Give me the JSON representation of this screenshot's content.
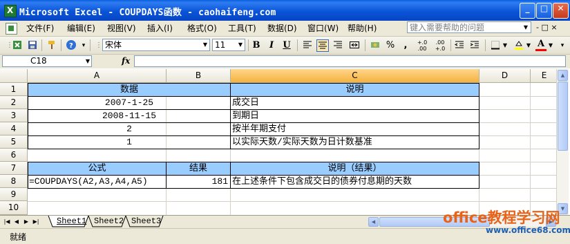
{
  "window": {
    "title": "Microsoft Excel - COUPDAYS函数 - caohaifeng.com",
    "buttons": {
      "minimize": "_",
      "maximize": "□",
      "close": "✕"
    }
  },
  "menu": {
    "items": [
      "文件(F)",
      "编辑(E)",
      "视图(V)",
      "插入(I)",
      "格式(O)",
      "工具(T)",
      "数据(D)",
      "窗口(W)",
      "帮助(H)"
    ],
    "help_placeholder": "键入需要帮助的问题",
    "controls": "- ♬ ×"
  },
  "toolbar": {
    "font_name": "宋体",
    "font_size": "11",
    "icons": [
      "excel-icon",
      "save-icon",
      "print-icon",
      "help-icon",
      "bold-icon",
      "italic-icon",
      "underline-icon",
      "align-left-icon",
      "align-center-icon",
      "align-right-icon",
      "merge-center-icon",
      "currency-icon",
      "percent-icon",
      "comma-icon",
      "increase-decimal-icon",
      "decrease-decimal-icon",
      "decrease-indent-icon",
      "increase-indent-icon",
      "borders-icon",
      "fill-color-icon",
      "font-color-icon"
    ],
    "bold_label": "B",
    "italic_label": "I",
    "underline_label": "U",
    "percent_label": "%",
    "comma_label": ",",
    "inc_decimal_label": "+.0 .00",
    "dec_decimal_label": ".00 +.0",
    "font_color_label": "A",
    "accent_colors": {
      "header_fill": "#99ccff",
      "active_header": "#f5b23e",
      "font_color_bar": "#ff0000"
    }
  },
  "formula_bar": {
    "name_box": "C18",
    "fx_label": "fx",
    "content": ""
  },
  "columns": [
    "A",
    "B",
    "C",
    "D",
    "E"
  ],
  "rows": [
    "1",
    "2",
    "3",
    "4",
    "5",
    "6",
    "7",
    "8",
    "9",
    "10"
  ],
  "cells": {
    "A1": "数据",
    "C1": "说明",
    "A2": "2007-1-25",
    "C2": "成交日",
    "A3": "2008-11-15",
    "C3": "到期日",
    "A4": "2",
    "C4": "按半年期支付",
    "A5": "1",
    "C5": "以实际天数/实际天数为日计数基准",
    "A7": "公式",
    "B7": "结果",
    "C7": "说明（结果）",
    "A8": "=COUPDAYS(A2,A3,A4,A5)",
    "B8": "181",
    "C8": "在上述条件下包含成交日的债券付息期的天数"
  },
  "sheets": [
    "Sheet1",
    "Sheet2",
    "Sheet3"
  ],
  "active_sheet": "Sheet1",
  "status": {
    "ready": "就绪"
  },
  "watermark": {
    "line1": "office教程学习网",
    "line2": "www.office68.com"
  }
}
